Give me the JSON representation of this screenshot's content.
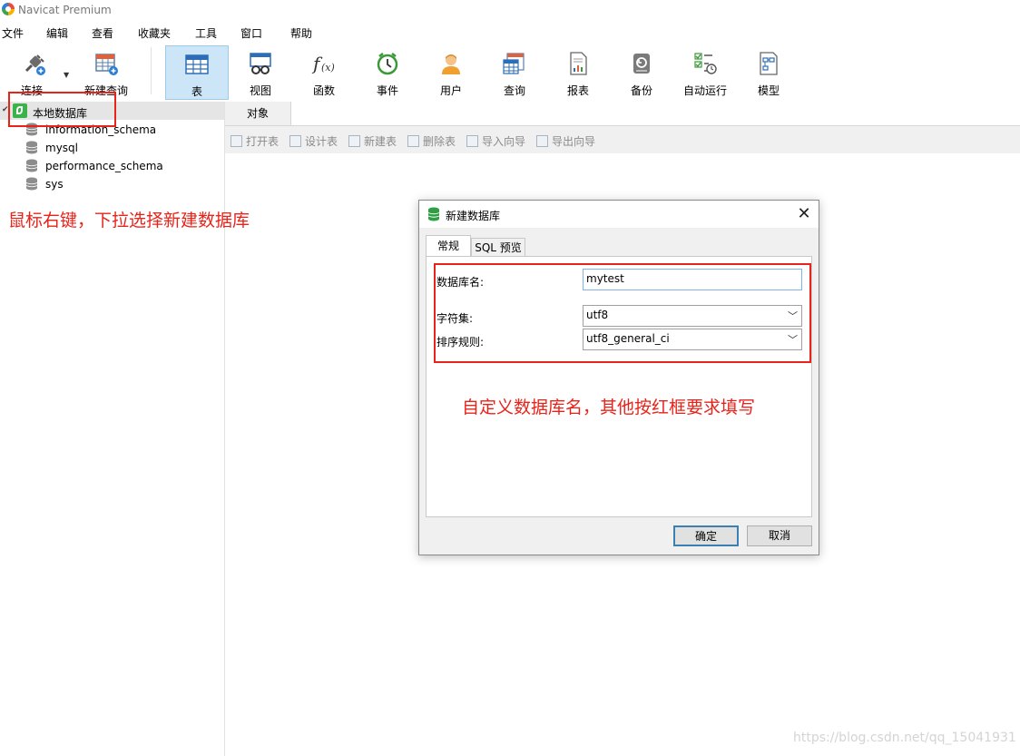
{
  "window": {
    "title": "Navicat Premium"
  },
  "menu": [
    "文件",
    "编辑",
    "查看",
    "收藏夹",
    "工具",
    "窗口",
    "帮助"
  ],
  "toolbar": {
    "connect": "连接",
    "new_query": "新建查询",
    "table": "表",
    "view": "视图",
    "function": "函数",
    "event": "事件",
    "user": "用户",
    "query": "查询",
    "report": "报表",
    "backup": "备份",
    "automation": "自动运行",
    "model": "模型"
  },
  "tree": {
    "root": "本地数据库",
    "databases": [
      "information_schema",
      "mysql",
      "performance_schema",
      "sys"
    ]
  },
  "tabs": {
    "objects": "对象"
  },
  "object_toolbar": {
    "open_table": "打开表",
    "design_table": "设计表",
    "new_table": "新建表",
    "delete_table": "删除表",
    "import_wizard": "导入向导",
    "export_wizard": "导出向导"
  },
  "annotations": {
    "left": "鼠标右键，下拉选择新建数据库",
    "dialog": "自定义数据库名，其他按红框要求填写"
  },
  "dialog": {
    "title": "新建数据库",
    "tab_general": "常规",
    "tab_sql": "SQL 预览",
    "db_name_label": "数据库名:",
    "db_name_value": "mytest",
    "charset_label": "字符集:",
    "charset_value": "utf8",
    "collation_label": "排序规则:",
    "collation_value": "utf8_general_ci",
    "ok": "确定",
    "cancel": "取消"
  },
  "watermark": "https://blog.csdn.net/qq_15041931",
  "colors": {
    "annotation_red": "#e8231a",
    "active_tab": "#cde6f7",
    "db_icon_green": "#3bb24a"
  }
}
